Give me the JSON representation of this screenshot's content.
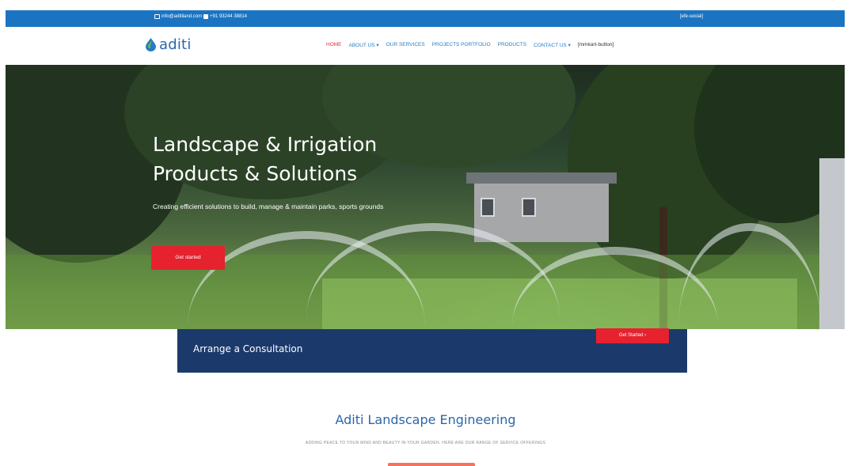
{
  "topbar": {
    "email": "info@aditiland.com",
    "phone": "+91 93244 38814",
    "social": "[efe-social]",
    "bg": "#1b74c2"
  },
  "nav": {
    "logo": "aditi",
    "items": [
      {
        "label": "HOME",
        "active": true
      },
      {
        "label": "ABOUT US ▾"
      },
      {
        "label": "OUR SERVICES"
      },
      {
        "label": "PROJECTS PORTFOLIO"
      },
      {
        "label": "PRODUCTS"
      },
      {
        "label": "CONTACT US ▾"
      },
      {
        "label": "[mmkart-button]"
      }
    ]
  },
  "hero": {
    "title_line1": "Landscape & Irrigation",
    "title_line2": "Products & Solutions",
    "subtitle": "Creating efficient solutions to build, manage & maintain parks, sports grounds",
    "cta": "Get started"
  },
  "consult": {
    "label": "Arrange a Consultation",
    "button": "Get Started ›",
    "bg": "#1b3a6b"
  },
  "section": {
    "title": "Aditi Landscape Engineering",
    "subtitle": "ADDING PEACE TO YOUR MIND AND BEAUTY IN YOUR GARDEN. HERE ARE OUR RANGE OF SERVICE OFFERINGS"
  },
  "colors": {
    "accent": "#e5222e",
    "brand": "#2a67a8"
  }
}
